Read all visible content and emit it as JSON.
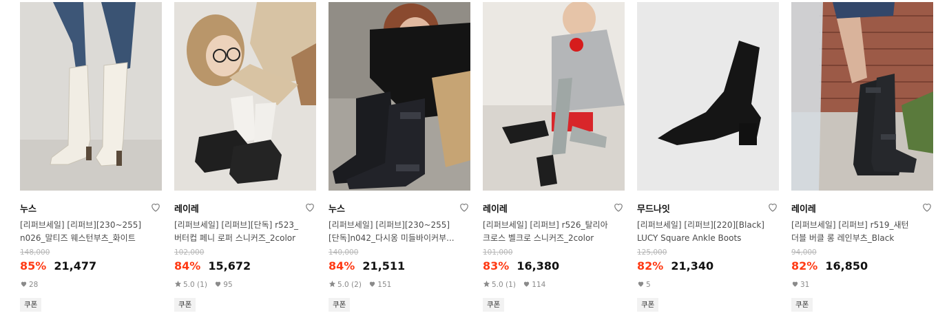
{
  "products": [
    {
      "brand": "누스",
      "title_line1": "[리퍼브세일] [리퍼브][230~255]",
      "title_line2": "n026_말티즈 웨스턴부츠_화이트",
      "original_price": "148,000",
      "discount": "85%",
      "price": "21,477",
      "rating": "",
      "review_count": "",
      "likes": "28",
      "coupon": "쿠폰",
      "image": "white-western-boots"
    },
    {
      "brand": "레이레",
      "title_line1": "[리퍼브세일] [리퍼브][단독] r523_",
      "title_line2": "버터컵 페니 로퍼 스니커즈_2color",
      "original_price": "102,000",
      "discount": "84%",
      "price": "15,672",
      "rating": "5.0",
      "review_count": "(1)",
      "likes": "95",
      "coupon": "쿠폰",
      "image": "black-penny-loafer"
    },
    {
      "brand": "누스",
      "title_line1": "[리퍼브세일] [리퍼브][230~255]",
      "title_line2": "[단독]n042_다시옹 미들바이커부...",
      "original_price": "140,000",
      "discount": "84%",
      "price": "21,511",
      "rating": "5.0",
      "review_count": "(2)",
      "likes": "151",
      "coupon": "쿠폰",
      "image": "black-biker-boots"
    },
    {
      "brand": "레이레",
      "title_line1": "[리퍼브세일] [리퍼브] r526_탈리아",
      "title_line2": "크로스 벨크로 스니커즈_2color",
      "original_price": "101,000",
      "discount": "83%",
      "price": "16,380",
      "rating": "5.0",
      "review_count": "(1)",
      "likes": "114",
      "coupon": "쿠폰",
      "image": "mary-jane-sneakers"
    },
    {
      "brand": "무드나잇",
      "title_line1": "[리퍼브세일] [리퍼브][220][Black]",
      "title_line2": "LUCY Square Ankle Boots",
      "original_price": "125,000",
      "discount": "82%",
      "price": "21,340",
      "rating": "",
      "review_count": "",
      "likes": "5",
      "coupon": "쿠폰",
      "image": "black-ankle-sock-boot"
    },
    {
      "brand": "레이레",
      "title_line1": "[리퍼브세일] [리퍼브] r519_새턴",
      "title_line2": "더블 버클 롱 레인부츠_Black",
      "original_price": "94,000",
      "discount": "82%",
      "price": "16,850",
      "rating": "",
      "review_count": "",
      "likes": "31",
      "coupon": "쿠폰",
      "image": "black-rain-boots"
    }
  ],
  "colors": {
    "discount": "#ff3a14",
    "text": "#111111",
    "muted": "#8a8a8a",
    "coupon_bg": "#f2f2f2"
  }
}
